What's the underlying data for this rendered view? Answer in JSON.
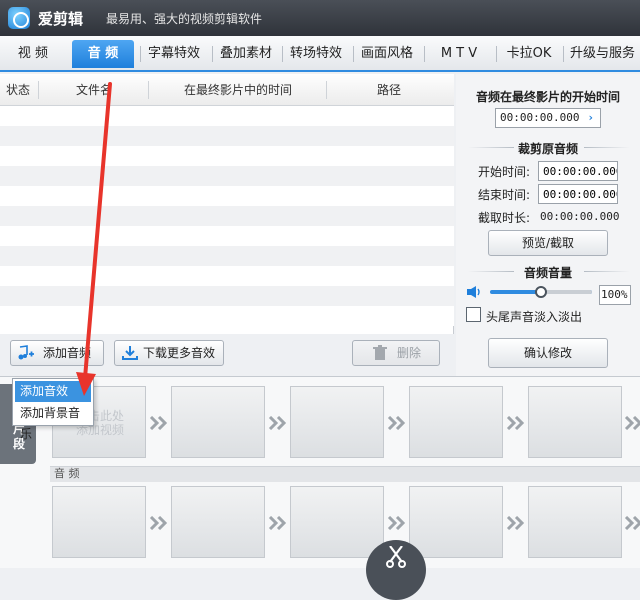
{
  "app": {
    "name": "爱剪辑",
    "slogan": "最易用、强大的视频剪辑软件"
  },
  "tabs": [
    {
      "label": "视  频"
    },
    {
      "label": "音  频",
      "active": true
    },
    {
      "label": "字幕特效"
    },
    {
      "label": "叠加素材"
    },
    {
      "label": "转场特效"
    },
    {
      "label": "画面风格"
    },
    {
      "label": "M T V"
    },
    {
      "label": "卡拉OK"
    },
    {
      "label": "升级与服务"
    }
  ],
  "table": {
    "columns": [
      "状态",
      "文件名",
      "在最终影片中的时间",
      "路径"
    ]
  },
  "buttons": {
    "add_audio": "添加音频",
    "download_more": "下载更多音效",
    "delete": "删除"
  },
  "popup_menu": {
    "items": [
      "添加音效",
      "添加背景音乐"
    ],
    "active_index": 0
  },
  "right_panel": {
    "start_title": "音频在最终影片的开始时间",
    "start_time": "00:00:00.000",
    "trim_title": "裁剪原音频",
    "start_label": "开始时间:",
    "start_value": "00:00:00.000",
    "end_label": "结束时间:",
    "end_value": "00:00:00.000",
    "duration_label": "截取时长:",
    "duration_value": "00:00:00.000",
    "preview_button": "预览/截取",
    "volume_title": "音频音量",
    "volume_value": "100%",
    "volume_level": 0.5,
    "fade_label": "头尾声音淡入淡出",
    "fade_checked": false,
    "confirm_button": "确认修改"
  },
  "timeline": {
    "side_tab_label": "片段",
    "video_slot_hint": "双击此处\n添加视频",
    "audio_label": "音 频"
  },
  "colors": {
    "accent": "#1f7fdb",
    "annotation_arrow": "#e8342b",
    "popup_highlight": "#3b93e0"
  }
}
